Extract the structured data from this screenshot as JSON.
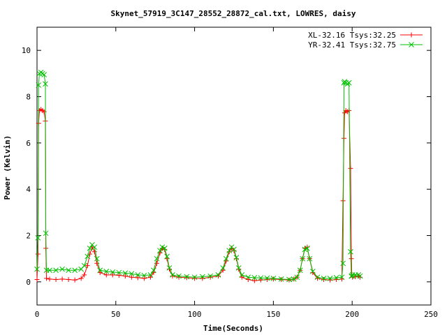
{
  "chart_data": {
    "type": "line",
    "title": "Skynet_57919_3C147_28552_28872_cal.txt, LOWRES, daisy",
    "xlabel": "Time(Seconds)",
    "ylabel": "Power (Kelvin)",
    "xlim": [
      0,
      250
    ],
    "ylim": [
      -1,
      11
    ],
    "x_ticks": [
      0,
      50,
      100,
      150,
      200,
      250
    ],
    "y_ticks": [
      0,
      2,
      4,
      6,
      8,
      10
    ],
    "grid": false,
    "legend_position": "top-right",
    "series": [
      {
        "name": "XL-32.16 Tsys:32.25",
        "color": "#ff0000",
        "marker": "plus",
        "x": [
          0,
          0.6,
          1,
          1.5,
          2.5,
          3.5,
          4.5,
          5.3,
          5.6,
          6,
          8,
          12,
          16,
          20,
          24,
          28,
          30,
          32,
          33.5,
          35,
          36.5,
          38,
          40,
          44,
          48,
          52,
          56,
          60,
          64,
          68,
          72,
          74,
          76,
          78,
          79.5,
          81,
          82.5,
          84,
          86,
          90,
          95,
          100,
          105,
          110,
          115,
          118,
          120,
          122,
          123.5,
          125,
          126.5,
          128,
          130,
          134,
          138,
          142,
          146,
          150,
          155,
          160,
          163,
          165,
          167,
          168.5,
          170,
          171.5,
          173,
          175,
          178,
          182,
          186,
          190,
          193.5,
          194.2,
          194.8,
          195.2,
          196,
          197,
          198,
          199,
          199.5,
          199.8,
          200.2,
          202,
          204,
          205
        ],
        "y": [
          0.1,
          1.2,
          6.85,
          7.4,
          7.45,
          7.4,
          7.35,
          6.95,
          1.45,
          0.15,
          0.12,
          0.1,
          0.12,
          0.1,
          0.08,
          0.15,
          0.3,
          0.7,
          1.2,
          1.5,
          1.3,
          0.8,
          0.4,
          0.3,
          0.3,
          0.28,
          0.25,
          0.2,
          0.18,
          0.15,
          0.2,
          0.4,
          0.8,
          1.25,
          1.45,
          1.4,
          1.0,
          0.55,
          0.25,
          0.2,
          0.18,
          0.15,
          0.15,
          0.2,
          0.25,
          0.5,
          0.9,
          1.3,
          1.45,
          1.35,
          1.0,
          0.55,
          0.2,
          0.1,
          0.05,
          0.08,
          0.1,
          0.12,
          0.1,
          0.08,
          0.12,
          0.2,
          0.5,
          1.0,
          1.45,
          1.5,
          1.0,
          0.4,
          0.15,
          0.1,
          0.08,
          0.1,
          0.12,
          3.5,
          6.2,
          7.3,
          7.4,
          7.35,
          7.4,
          4.9,
          1.0,
          0.3,
          0.2,
          0.22,
          0.25,
          0.2
        ]
      },
      {
        "name": "YR-32.41 Tsys:32.75",
        "color": "#00c000",
        "marker": "cross",
        "x": [
          0,
          0.6,
          1,
          1.5,
          2.5,
          3.5,
          4.5,
          5.3,
          5.6,
          6,
          8,
          12,
          16,
          20,
          24,
          28,
          30,
          32,
          33.5,
          35,
          36.5,
          38,
          40,
          44,
          48,
          52,
          56,
          60,
          64,
          68,
          72,
          74,
          76,
          78,
          79.5,
          81,
          82.5,
          84,
          86,
          90,
          95,
          100,
          105,
          110,
          115,
          118,
          120,
          122,
          123.5,
          125,
          126.5,
          128,
          130,
          134,
          138,
          142,
          146,
          150,
          155,
          160,
          163,
          165,
          167,
          168.5,
          170,
          171.5,
          173,
          175,
          178,
          182,
          186,
          190,
          193.5,
          194.2,
          194.8,
          195.2,
          196,
          197,
          198,
          199,
          199.5,
          199.8,
          200.2,
          202,
          204,
          205
        ],
        "y": [
          0.55,
          1.9,
          8.5,
          9.0,
          9.05,
          9.0,
          8.95,
          8.55,
          2.1,
          0.5,
          0.5,
          0.5,
          0.55,
          0.5,
          0.5,
          0.55,
          0.7,
          1.1,
          1.45,
          1.6,
          1.5,
          1.0,
          0.5,
          0.45,
          0.42,
          0.4,
          0.38,
          0.35,
          0.3,
          0.28,
          0.3,
          0.5,
          1.0,
          1.35,
          1.5,
          1.45,
          1.1,
          0.6,
          0.3,
          0.25,
          0.22,
          0.2,
          0.22,
          0.25,
          0.3,
          0.6,
          1.0,
          1.35,
          1.5,
          1.4,
          1.05,
          0.6,
          0.3,
          0.2,
          0.18,
          0.17,
          0.16,
          0.15,
          0.12,
          0.1,
          0.12,
          0.2,
          0.5,
          1.0,
          1.4,
          1.45,
          1.0,
          0.45,
          0.2,
          0.15,
          0.15,
          0.18,
          0.2,
          0.8,
          8.6,
          8.65,
          8.6,
          8.55,
          8.6,
          1.3,
          0.25,
          0.25,
          0.3,
          0.3,
          0.3,
          0.25
        ]
      }
    ]
  }
}
